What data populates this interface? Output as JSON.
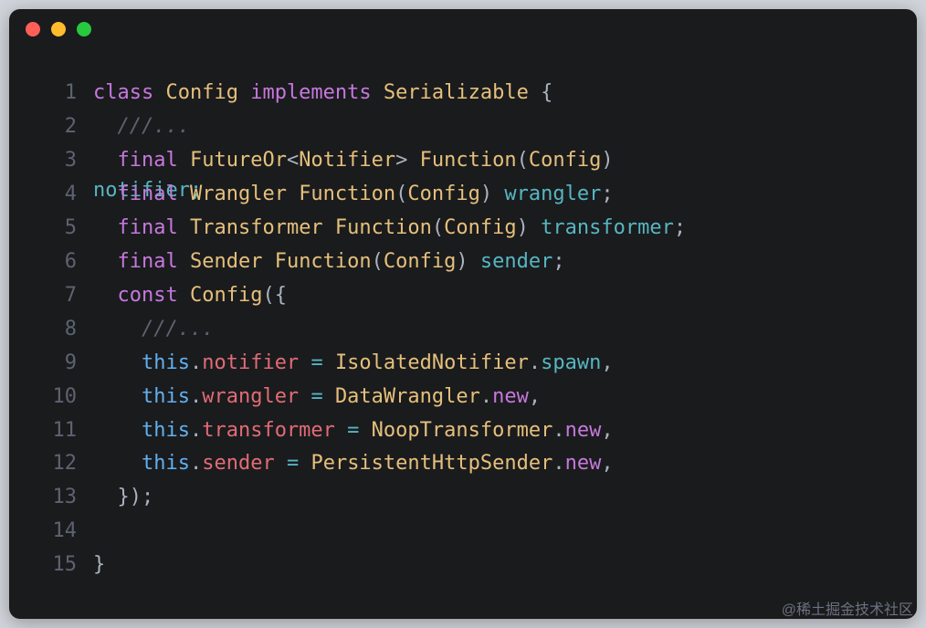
{
  "window": {
    "buttons": [
      "close",
      "minimize",
      "zoom"
    ]
  },
  "watermark": "@稀土掘金技术社区",
  "code": {
    "lines": [
      {
        "n": "1",
        "t": [
          [
            "tok-kw",
            "class "
          ],
          [
            "tok-type",
            "Config "
          ],
          [
            "tok-kw",
            "implements "
          ],
          [
            "tok-type",
            "Serializable "
          ],
          [
            "tok-punc",
            "{"
          ]
        ]
      },
      {
        "n": "2",
        "t": [
          [
            "tok-punc",
            "  "
          ],
          [
            "tok-cmt",
            "///..."
          ]
        ]
      },
      {
        "n": "3",
        "t": [
          [
            "tok-punc",
            "  "
          ],
          [
            "tok-kw",
            "final "
          ],
          [
            "tok-type",
            "FutureOr"
          ],
          [
            "tok-punc",
            "<"
          ],
          [
            "tok-type",
            "Notifier"
          ],
          [
            "tok-punc",
            "> "
          ],
          [
            "tok-type",
            "Function"
          ],
          [
            "tok-punc",
            "("
          ],
          [
            "tok-type",
            "Config"
          ],
          [
            "tok-punc",
            ")"
          ]
        ],
        "overlay": "notifier;"
      },
      {
        "n": "4",
        "t": [
          [
            "tok-punc",
            "  "
          ],
          [
            "tok-kw",
            "final "
          ],
          [
            "tok-type",
            "Wrangler Function"
          ],
          [
            "tok-punc",
            "("
          ],
          [
            "tok-type",
            "Config"
          ],
          [
            "tok-punc",
            ") "
          ],
          [
            "tok-var",
            "wrangler"
          ],
          [
            "tok-punc",
            ";"
          ]
        ]
      },
      {
        "n": "5",
        "t": [
          [
            "tok-punc",
            "  "
          ],
          [
            "tok-kw",
            "final "
          ],
          [
            "tok-type",
            "Transformer Function"
          ],
          [
            "tok-punc",
            "("
          ],
          [
            "tok-type",
            "Config"
          ],
          [
            "tok-punc",
            ") "
          ],
          [
            "tok-var",
            "transformer"
          ],
          [
            "tok-punc",
            ";"
          ]
        ]
      },
      {
        "n": "6",
        "t": [
          [
            "tok-punc",
            "  "
          ],
          [
            "tok-kw",
            "final "
          ],
          [
            "tok-type",
            "Sender Function"
          ],
          [
            "tok-punc",
            "("
          ],
          [
            "tok-type",
            "Config"
          ],
          [
            "tok-punc",
            ") "
          ],
          [
            "tok-var",
            "sender"
          ],
          [
            "tok-punc",
            ";"
          ]
        ]
      },
      {
        "n": "7",
        "t": [
          [
            "tok-punc",
            "  "
          ],
          [
            "tok-kw",
            "const "
          ],
          [
            "tok-type",
            "Config"
          ],
          [
            "tok-punc",
            "({"
          ]
        ]
      },
      {
        "n": "8",
        "t": [
          [
            "tok-punc",
            "    "
          ],
          [
            "tok-cmt",
            "///..."
          ]
        ]
      },
      {
        "n": "9",
        "t": [
          [
            "tok-punc",
            "    "
          ],
          [
            "tok-fn",
            "this"
          ],
          [
            "tok-punc",
            "."
          ],
          [
            "tok-prop",
            "notifier"
          ],
          [
            "tok-punc",
            " "
          ],
          [
            "tok-op",
            "="
          ],
          [
            "tok-punc",
            " "
          ],
          [
            "tok-type",
            "IsolatedNotifier"
          ],
          [
            "tok-punc",
            "."
          ],
          [
            "tok-var",
            "spawn"
          ],
          [
            "tok-punc",
            ","
          ]
        ]
      },
      {
        "n": "10",
        "t": [
          [
            "tok-punc",
            "    "
          ],
          [
            "tok-fn",
            "this"
          ],
          [
            "tok-punc",
            "."
          ],
          [
            "tok-prop",
            "wrangler"
          ],
          [
            "tok-punc",
            " "
          ],
          [
            "tok-op",
            "="
          ],
          [
            "tok-punc",
            " "
          ],
          [
            "tok-type",
            "DataWrangler"
          ],
          [
            "tok-punc",
            "."
          ],
          [
            "tok-kw",
            "new"
          ],
          [
            "tok-punc",
            ","
          ]
        ]
      },
      {
        "n": "11",
        "t": [
          [
            "tok-punc",
            "    "
          ],
          [
            "tok-fn",
            "this"
          ],
          [
            "tok-punc",
            "."
          ],
          [
            "tok-prop",
            "transformer"
          ],
          [
            "tok-punc",
            " "
          ],
          [
            "tok-op",
            "="
          ],
          [
            "tok-punc",
            " "
          ],
          [
            "tok-type",
            "NoopTransformer"
          ],
          [
            "tok-punc",
            "."
          ],
          [
            "tok-kw",
            "new"
          ],
          [
            "tok-punc",
            ","
          ]
        ]
      },
      {
        "n": "12",
        "t": [
          [
            "tok-punc",
            "    "
          ],
          [
            "tok-fn",
            "this"
          ],
          [
            "tok-punc",
            "."
          ],
          [
            "tok-prop",
            "sender"
          ],
          [
            "tok-punc",
            " "
          ],
          [
            "tok-op",
            "="
          ],
          [
            "tok-punc",
            " "
          ],
          [
            "tok-type",
            "PersistentHttpSender"
          ],
          [
            "tok-punc",
            "."
          ],
          [
            "tok-kw",
            "new"
          ],
          [
            "tok-punc",
            ","
          ]
        ]
      },
      {
        "n": "13",
        "t": [
          [
            "tok-punc",
            "  });"
          ]
        ]
      },
      {
        "n": "14",
        "t": [
          [
            "tok-punc",
            ""
          ]
        ]
      },
      {
        "n": "15",
        "t": [
          [
            "tok-punc",
            "}"
          ]
        ]
      }
    ]
  }
}
